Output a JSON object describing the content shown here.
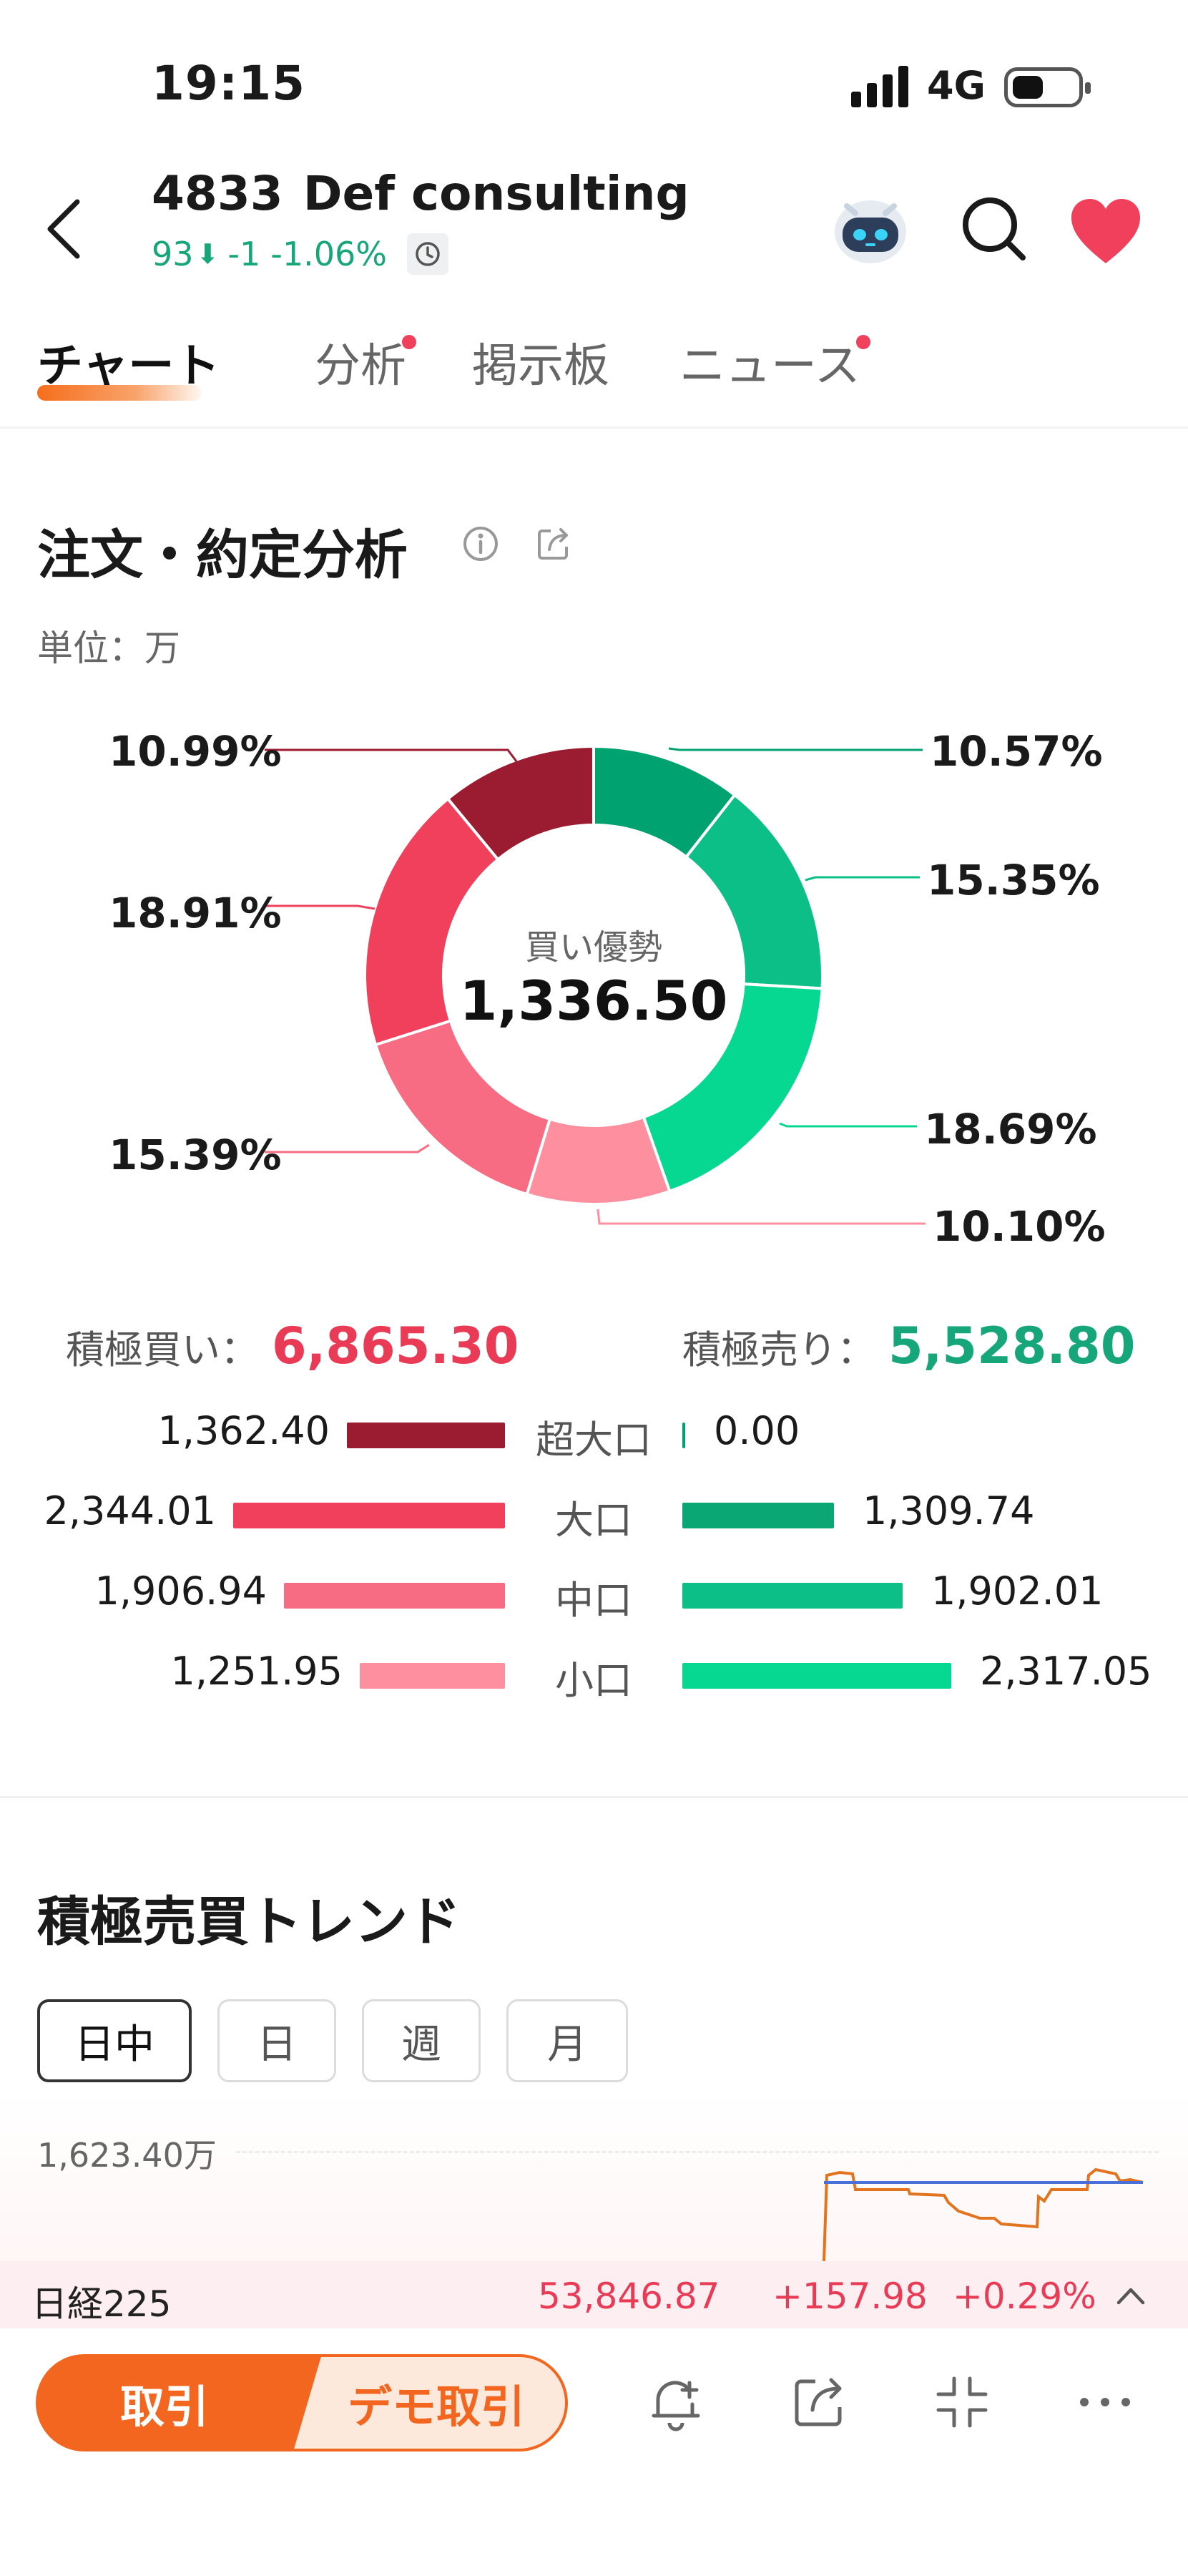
{
  "status_bar": {
    "time": "19:15",
    "network": "4G"
  },
  "header": {
    "code": "4833",
    "name": "Def consulting",
    "price": "93",
    "change": "-1",
    "change_pct": "-1.06%"
  },
  "tabs": [
    {
      "label": "チャート",
      "active": true,
      "dot": false
    },
    {
      "label": "分析",
      "active": false,
      "dot": true
    },
    {
      "label": "掲示板",
      "active": false,
      "dot": false
    },
    {
      "label": "ニュース",
      "active": false,
      "dot": true
    }
  ],
  "order_analysis": {
    "title": "注文・約定分析",
    "unit": "単位：万",
    "center_label": "買い優勢",
    "center_value": "1,336.50",
    "buy_label": "積極買い：",
    "buy_total": "6,865.30",
    "sell_label": "積極売り：",
    "sell_total": "5,528.80",
    "rows": [
      {
        "label": "超大口",
        "buy": "1,362.40",
        "sell": "0.00",
        "buy_value": 1362.4,
        "sell_value": 0.0
      },
      {
        "label": "大口",
        "buy": "2,344.01",
        "sell": "1,309.74",
        "buy_value": 2344.01,
        "sell_value": 1309.74
      },
      {
        "label": "中口",
        "buy": "1,906.94",
        "sell": "1,902.01",
        "buy_value": 1906.94,
        "sell_value": 1902.01
      },
      {
        "label": "小口",
        "buy": "1,251.95",
        "sell": "2,317.05",
        "buy_value": 1251.95,
        "sell_value": 2317.05
      }
    ]
  },
  "chart_data": {
    "type": "pie",
    "slices": [
      {
        "label": "10.57%",
        "value": 10.57,
        "color": "#00a36f"
      },
      {
        "label": "15.35%",
        "value": 15.35,
        "color": "#0bbf86"
      },
      {
        "label": "18.69%",
        "value": 18.69,
        "color": "#06d892"
      },
      {
        "label": "10.10%",
        "value": 10.1,
        "color": "#fd8f9f"
      },
      {
        "label": "15.39%",
        "value": 15.39,
        "color": "#f76c82"
      },
      {
        "label": "18.91%",
        "value": 18.91,
        "color": "#f0405b"
      },
      {
        "label": "10.99%",
        "value": 10.99,
        "color": "#9b1c30"
      }
    ]
  },
  "trend": {
    "title": "積極売買トレンド",
    "periods": [
      {
        "label": "日中",
        "active": true
      },
      {
        "label": "日",
        "active": false
      },
      {
        "label": "週",
        "active": false
      },
      {
        "label": "月",
        "active": false
      }
    ],
    "y_max_label": "1,623.40万"
  },
  "index_bar": {
    "name": "日経225",
    "value": "53,846.87",
    "change": "+157.98",
    "change_pct": "+0.29%"
  },
  "bottom_bar": {
    "trade_label": "取引",
    "demo_label": "デモ取引",
    "icons": [
      "add-alert-icon",
      "share-icon",
      "collapse-icon",
      "more-icon"
    ]
  },
  "colors": {
    "accent": "#f2661f",
    "buy": "#ea3b56",
    "sell": "#16a67a"
  }
}
